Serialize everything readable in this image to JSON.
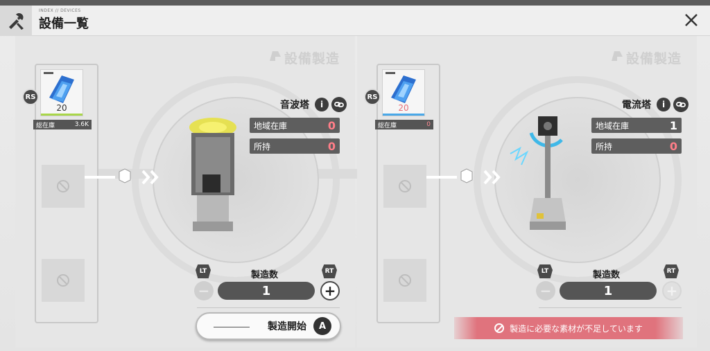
{
  "window": {
    "title": "設備一覧",
    "subtitle": "INDEX // DEVICES",
    "watermark": "設備製造"
  },
  "colors": {
    "accent_red": "#e0737d",
    "panel_bg": "#e6e6e6",
    "dark_chip": "#555555"
  },
  "left_panel": {
    "device_name": "音波塔",
    "material": {
      "button": "RS",
      "count": "20",
      "stock_label": "総在庫",
      "stock_value": "3.6K",
      "stripe_color": "#a9d64a"
    },
    "stats": [
      {
        "label": "地域在庫",
        "value": "0",
        "state": "red"
      },
      {
        "label": "所持",
        "value": "0",
        "state": "red"
      }
    ],
    "quantity_label": "製造数",
    "quantity": "1",
    "lt": "LT",
    "rt": "RT",
    "start_label": "製造開始",
    "start_key": "A"
  },
  "right_panel": {
    "device_name": "電流塔",
    "material": {
      "button": "RS",
      "count": "20",
      "stock_label": "総在庫",
      "stock_value": "0",
      "stripe_color": "#4aa8e8"
    },
    "stats": [
      {
        "label": "地域在庫",
        "value": "1",
        "state": "white"
      },
      {
        "label": "所持",
        "value": "0",
        "state": "red"
      }
    ],
    "quantity_label": "製造数",
    "quantity": "1",
    "lt": "LT",
    "rt": "RT",
    "warning": "製造に必要な素材が不足しています"
  }
}
